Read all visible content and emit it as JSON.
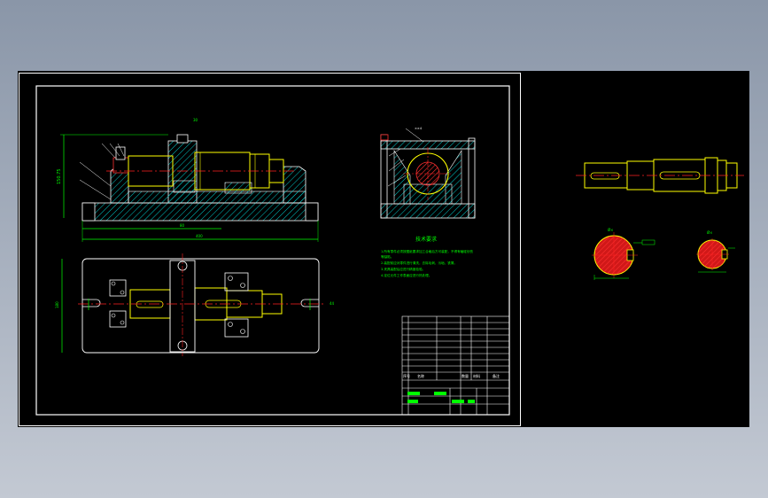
{
  "labels": {
    "top_mark": "30",
    "front_height": "150.75",
    "front_width_inner": "80",
    "front_width_total": "400",
    "plan_height": "180",
    "plan_right": "44",
    "side_mark": "××4",
    "notes_title": "技术要求",
    "part_a_size": "Ø×",
    "part_b_size": "Ø×"
  },
  "notes": {
    "line1": "1.所有零件必须按图纸要求加工合格后方可装配，不得有磕碰划伤",
    "line2": "等缺陷。",
    "line3": "2.装配前应对零件进行清洗，去除毛刺、污垢、铁屑。",
    "line4": "3.夹具装配后应进行精度检验。",
    "line5": "4.定位元件工作表面应进行热处理。"
  },
  "title_block": {
    "c1": "序号",
    "c2": "名称",
    "c3": "数量",
    "c4": "材料",
    "c5": "备注"
  },
  "colors": {
    "background": "#000000",
    "frame": "#ffffff",
    "part_outline": "#ffff00",
    "hatch": "#00c8c8",
    "centerline": "#ff2020",
    "dimension": "#00ff00",
    "section_fill": "#d01818",
    "table_green": "#00ff00"
  }
}
